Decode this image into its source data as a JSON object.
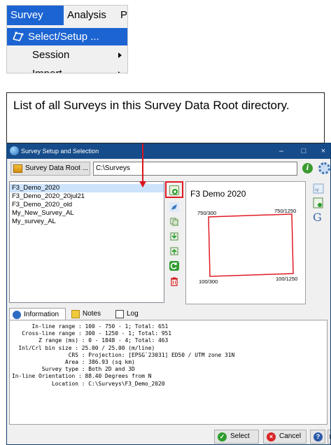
{
  "menu": {
    "menubar": [
      "Survey",
      "Analysis",
      "P"
    ],
    "items": [
      {
        "label": "Select/Setup ...",
        "icon": "select-setup-icon",
        "selected": true
      },
      {
        "label": "Session",
        "submenu": true
      },
      {
        "label": "Import",
        "submenu": true
      }
    ]
  },
  "annotation": {
    "text": "List of all Surveys in this Survey Data Root directory.",
    "arrow_color": "#d8141c"
  },
  "dialog": {
    "title": "Survey Setup and Selection",
    "window_buttons": [
      "–",
      "□",
      "×"
    ],
    "data_root_button": "Survey Data Root ...",
    "data_root_path": "C:\\Surveys",
    "surveys": [
      "F3_Demo_2020",
      "F3_Demo_2020_20jul21",
      "F3_Demo_2020_old",
      "My_New_Survey_AL",
      "My_survey_AL"
    ],
    "selected_survey": "F3_Demo_2020",
    "map": {
      "title": "F3 Demo 2020",
      "corners": {
        "top_left": "750/300",
        "top_right": "750/1250",
        "bottom_left": "100/300",
        "bottom_right": "100/1250"
      },
      "outline_color": "#e01b24"
    },
    "tabs": [
      "Information",
      "Notes",
      "Log"
    ],
    "active_tab": "Information",
    "info_lines": [
      "      In-line range : 100 - 750 - 1; Total: 651",
      "   Cross-line range : 300 - 1250 - 1; Total: 951",
      "        Z range (ms) : 0 - 1848 - 4; Total: 463",
      "  Inl/Crl bin size : 25.00 / 25.00 (m/line)",
      "                 CRS : Projection: [EPSG`23031] ED50 / UTM zone 31N",
      "                Area : 386.93 (sq km)",
      "         Survey type : Both 2D and 3D",
      "In-line Orientation : 88.40 Degrees from N",
      "            Location : C:\\Surveys\\F3_Demo_2020"
    ],
    "buttons": {
      "select": "Select",
      "cancel": "Cancel"
    },
    "colors": {
      "title_bar": "#164c8a",
      "selection": "#1c64d2",
      "highlight": "#e01b24"
    }
  }
}
